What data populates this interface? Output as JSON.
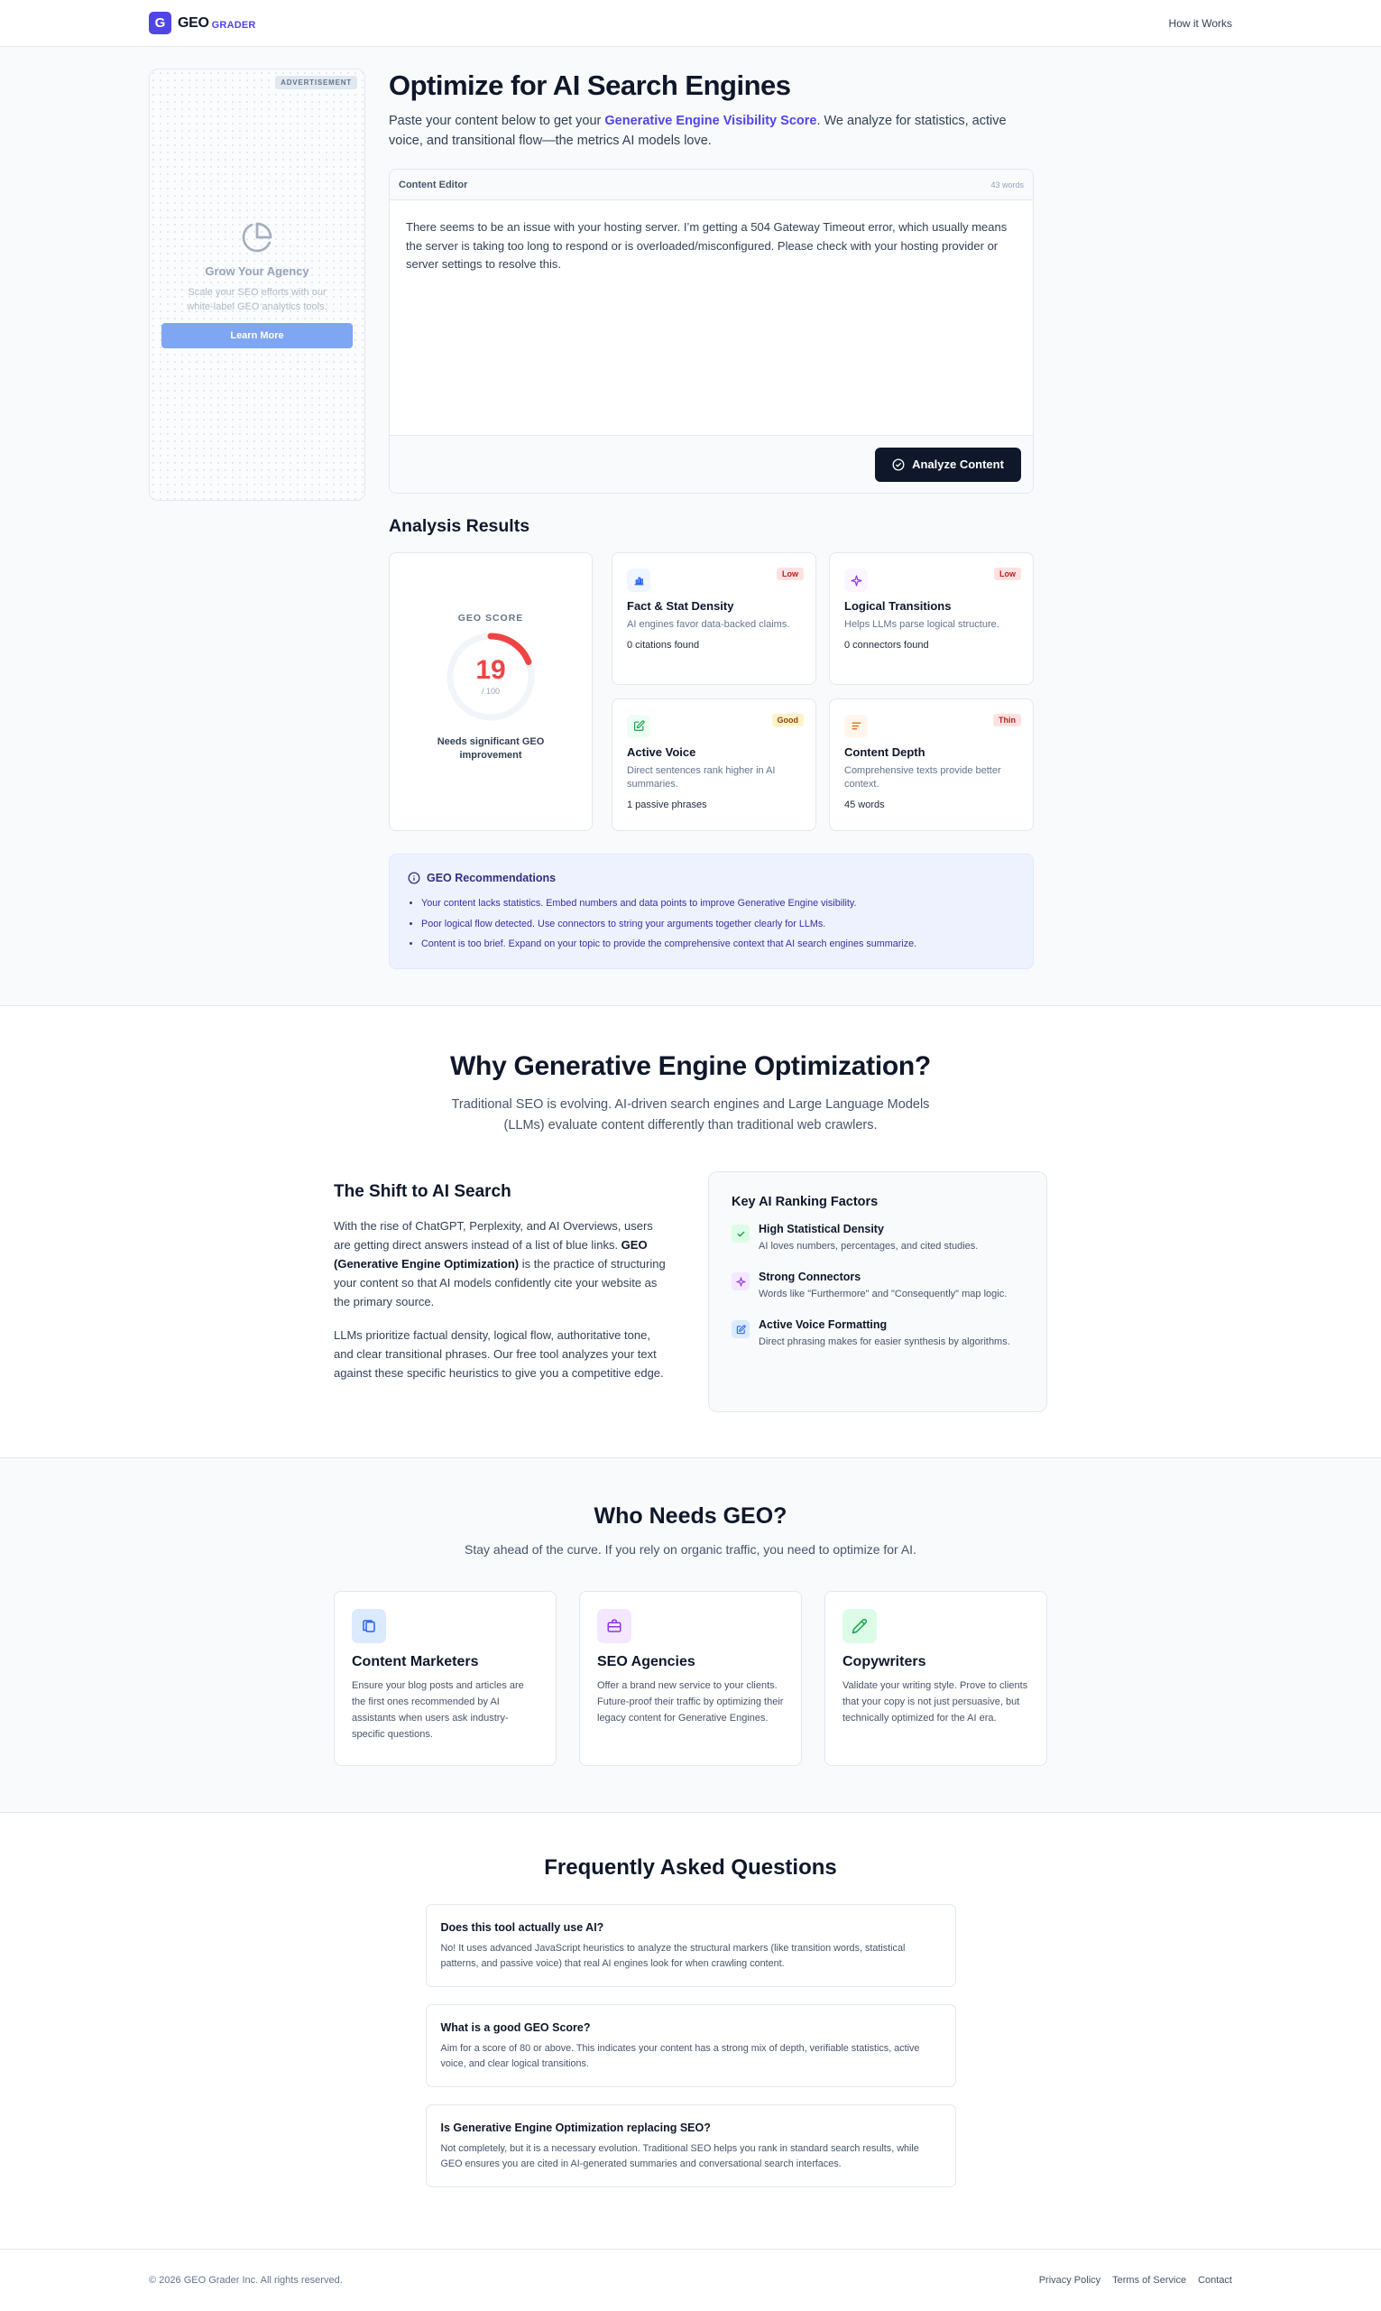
{
  "header": {
    "logo_letter": "G",
    "brand_main": "GEO",
    "brand_sub": "GRADER",
    "nav_how": "How it Works"
  },
  "ad": {
    "tag": "ADVERTISEMENT",
    "icon": "pie-chart-icon",
    "title": "Grow Your Agency",
    "text": "Scale your SEO efforts with our white-label GEO analytics tools.",
    "button": "Learn More"
  },
  "hero": {
    "title": "Optimize for AI Search Engines",
    "sub_before": "Paste your content below to get your ",
    "sub_accent": "Generative Engine Visibility Score",
    "sub_after": ". We analyze for statistics, active voice, and transitional flow—the metrics AI models love."
  },
  "editor": {
    "label": "Content Editor",
    "word_count": "43 words",
    "content": "There seems to be an issue with your hosting server. I’m getting a 504 Gateway Timeout error, which usually means the server is taking too long to respond or is overloaded/misconfigured. Please check with your hosting provider or server settings to resolve this.",
    "analyze_button": "Analyze Content"
  },
  "results": {
    "title": "Analysis Results",
    "score_label": "GEO SCORE",
    "score": "19",
    "score_max": "/ 100",
    "score_fraction": 0.19,
    "score_note": "Needs significant GEO improvement",
    "metrics": [
      {
        "icon": "bar-chart-icon",
        "badge": "Low",
        "title": "Fact & Stat Density",
        "desc": "AI engines favor data-backed claims.",
        "value": "0 citations found"
      },
      {
        "icon": "sparkle-icon",
        "badge": "Low",
        "title": "Logical Transitions",
        "desc": "Helps LLMs parse logical structure.",
        "value": "0 connectors found"
      },
      {
        "icon": "edit-icon",
        "badge": "Good",
        "title": "Active Voice",
        "desc": "Direct sentences rank higher in AI summaries.",
        "value": "1 passive phrases"
      },
      {
        "icon": "align-left-icon",
        "badge": "Thin",
        "title": "Content Depth",
        "desc": "Comprehensive texts provide better context.",
        "value": "45 words"
      }
    ]
  },
  "recommendations": {
    "title": "GEO Recommendations",
    "items": [
      "Your content lacks statistics. Embed numbers and data points to improve Generative Engine visibility.",
      "Poor logical flow detected. Use connectors to string your arguments together clearly for LLMs.",
      "Content is too brief. Expand on your topic to provide the comprehensive context that AI search engines summarize."
    ]
  },
  "why": {
    "title": "Why Generative Engine Optimization?",
    "sub": "Traditional SEO is evolving. AI-driven search engines and Large Language Models (LLMs) evaluate content differently than traditional web crawlers.",
    "shift_title": "The Shift to AI Search",
    "p1_before": "With the rise of ChatGPT, Perplexity, and AI Overviews, users are getting direct answers instead of a list of blue links. ",
    "p1_bold": "GEO (Generative Engine Optimization)",
    "p1_after": " is the practice of structuring your content so that AI models confidently cite your website as the primary source.",
    "p2": "LLMs prioritize factual density, logical flow, authoritative tone, and clear transitional phrases. Our free tool analyzes your text against these specific heuristics to give you a competitive edge.",
    "factors_title": "Key AI Ranking Factors",
    "factors": [
      {
        "icon": "check-icon",
        "title": "High Statistical Density",
        "desc": "AI loves numbers, percentages, and cited studies."
      },
      {
        "icon": "sparkle-icon",
        "title": "Strong Connectors",
        "desc": "Words like \"Furthermore\" and \"Consequently\" map logic."
      },
      {
        "icon": "edit-icon",
        "title": "Active Voice Formatting",
        "desc": "Direct phrasing makes for easier synthesis by algorithms."
      }
    ]
  },
  "who": {
    "title": "Who Needs GEO?",
    "sub": "Stay ahead of the curve. If you rely on organic traffic, you need to optimize for AI.",
    "cards": [
      {
        "icon": "copy-icon",
        "title": "Content Marketers",
        "text": "Ensure your blog posts and articles are the first ones recommended by AI assistants when users ask industry-specific questions."
      },
      {
        "icon": "briefcase-icon",
        "title": "SEO Agencies",
        "text": "Offer a brand new service to your clients. Future-proof their traffic by optimizing their legacy content for Generative Engines."
      },
      {
        "icon": "pencil-icon",
        "title": "Copywriters",
        "text": "Validate your writing style. Prove to clients that your copy is not just persuasive, but technically optimized for the AI era."
      }
    ]
  },
  "faq": {
    "title": "Frequently Asked Questions",
    "items": [
      {
        "q": "Does this tool actually use AI?",
        "a": "No! It uses advanced JavaScript heuristics to analyze the structural markers (like transition words, statistical patterns, and passive voice) that real AI engines look for when crawling content."
      },
      {
        "q": "What is a good GEO Score?",
        "a": "Aim for a score of 80 or above. This indicates your content has a strong mix of depth, verifiable statistics, active voice, and clear logical transitions."
      },
      {
        "q": "Is Generative Engine Optimization replacing SEO?",
        "a": "Not completely, but it is a necessary evolution. Traditional SEO helps you rank in standard search results, while GEO ensures you are cited in AI-generated summaries and conversational search interfaces."
      }
    ]
  },
  "footer": {
    "copyright": "© 2026 GEO Grader Inc. All rights reserved.",
    "links": [
      "Privacy Policy",
      "Terms of Service",
      "Contact"
    ]
  },
  "colors": {
    "brand": "#4f46e5",
    "score_red": "#ef4444",
    "ink": "#0f172a"
  }
}
